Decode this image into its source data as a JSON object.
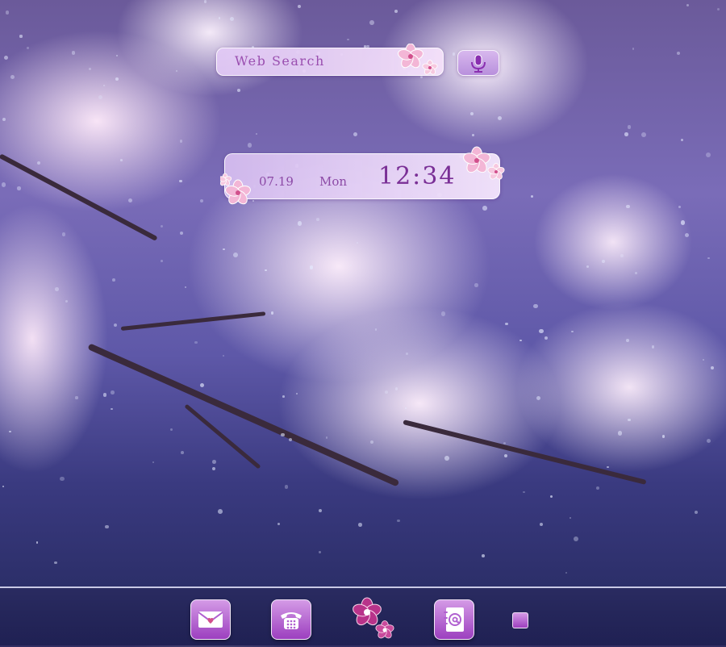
{
  "search": {
    "label": "Web Search"
  },
  "clock": {
    "date": "07.19",
    "day": "Mon",
    "time": "12:34"
  },
  "dock": {
    "items": [
      {
        "icon": "mail-icon"
      },
      {
        "icon": "phone-icon"
      },
      {
        "icon": "app-drawer-blossom-icon"
      },
      {
        "icon": "contacts-icon"
      },
      {
        "icon": "square-icon"
      }
    ]
  },
  "colors": {
    "accent": "#9c3fbf",
    "text": "#8c4aa6",
    "bar_light": "#f5e1fa"
  }
}
